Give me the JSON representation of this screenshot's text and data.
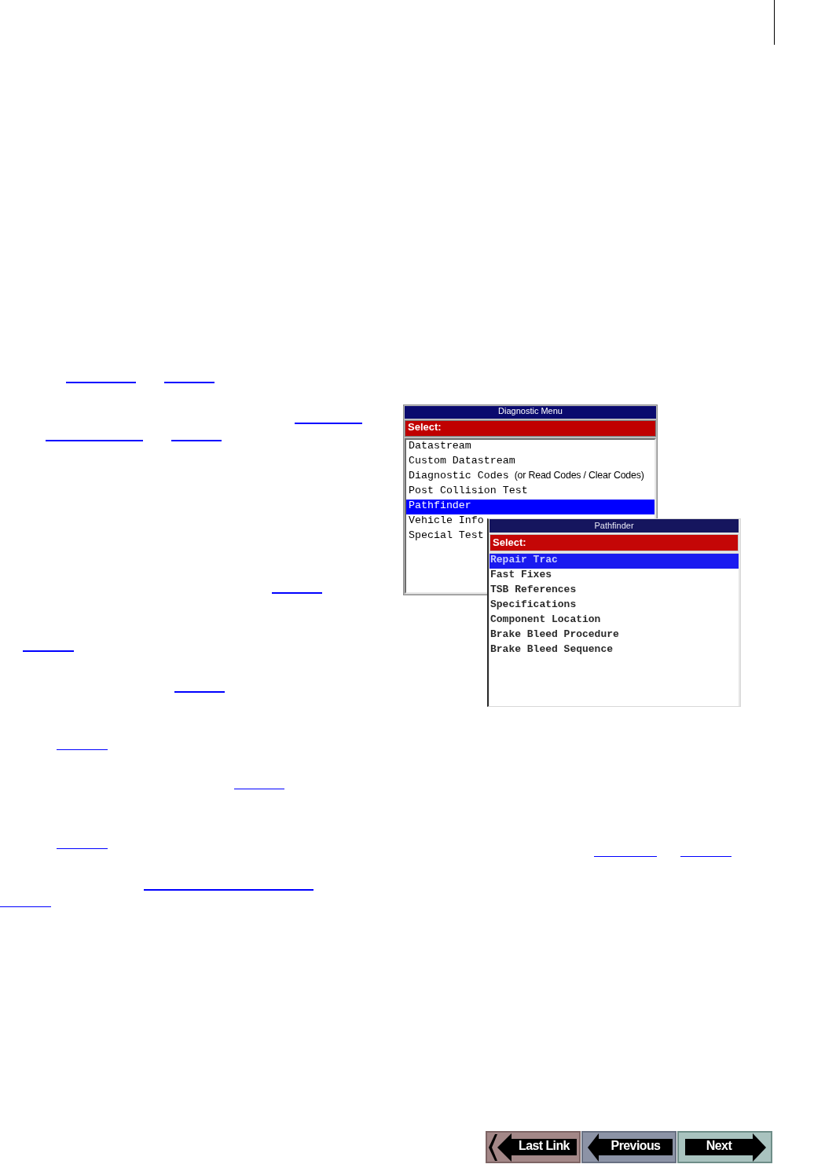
{
  "figure": {
    "windows": [
      {
        "title": "Diagnostic Menu",
        "prompt": "Select:",
        "items": [
          {
            "label": "Datastream",
            "selected": false
          },
          {
            "label": "Custom Datastream",
            "selected": false
          },
          {
            "label": "Diagnostic Codes",
            "note": "(or Read Codes / Clear Codes)",
            "selected": false
          },
          {
            "label": "Post Collision Test",
            "selected": false
          },
          {
            "label": "Pathfinder",
            "selected": true
          },
          {
            "label": "Vehicle Info",
            "selected": false
          },
          {
            "label": "Special Test",
            "selected": false
          }
        ]
      },
      {
        "title": "Pathfinder",
        "prompt": "Select:",
        "items": [
          {
            "label": "Repair Trac",
            "selected": true
          },
          {
            "label": "Fast Fixes",
            "selected": false
          },
          {
            "label": "TSB References",
            "selected": false
          },
          {
            "label": "Specifications",
            "selected": false
          },
          {
            "label": "Component Location",
            "selected": false
          },
          {
            "label": "Brake Bleed Procedure",
            "selected": false
          },
          {
            "label": "Brake Bleed Sequence",
            "selected": false
          }
        ]
      }
    ]
  },
  "navigation": [
    {
      "label": "Last Link",
      "kind": "double-back"
    },
    {
      "label": "Previous",
      "kind": "back"
    },
    {
      "label": "Next",
      "kind": "forward"
    }
  ]
}
